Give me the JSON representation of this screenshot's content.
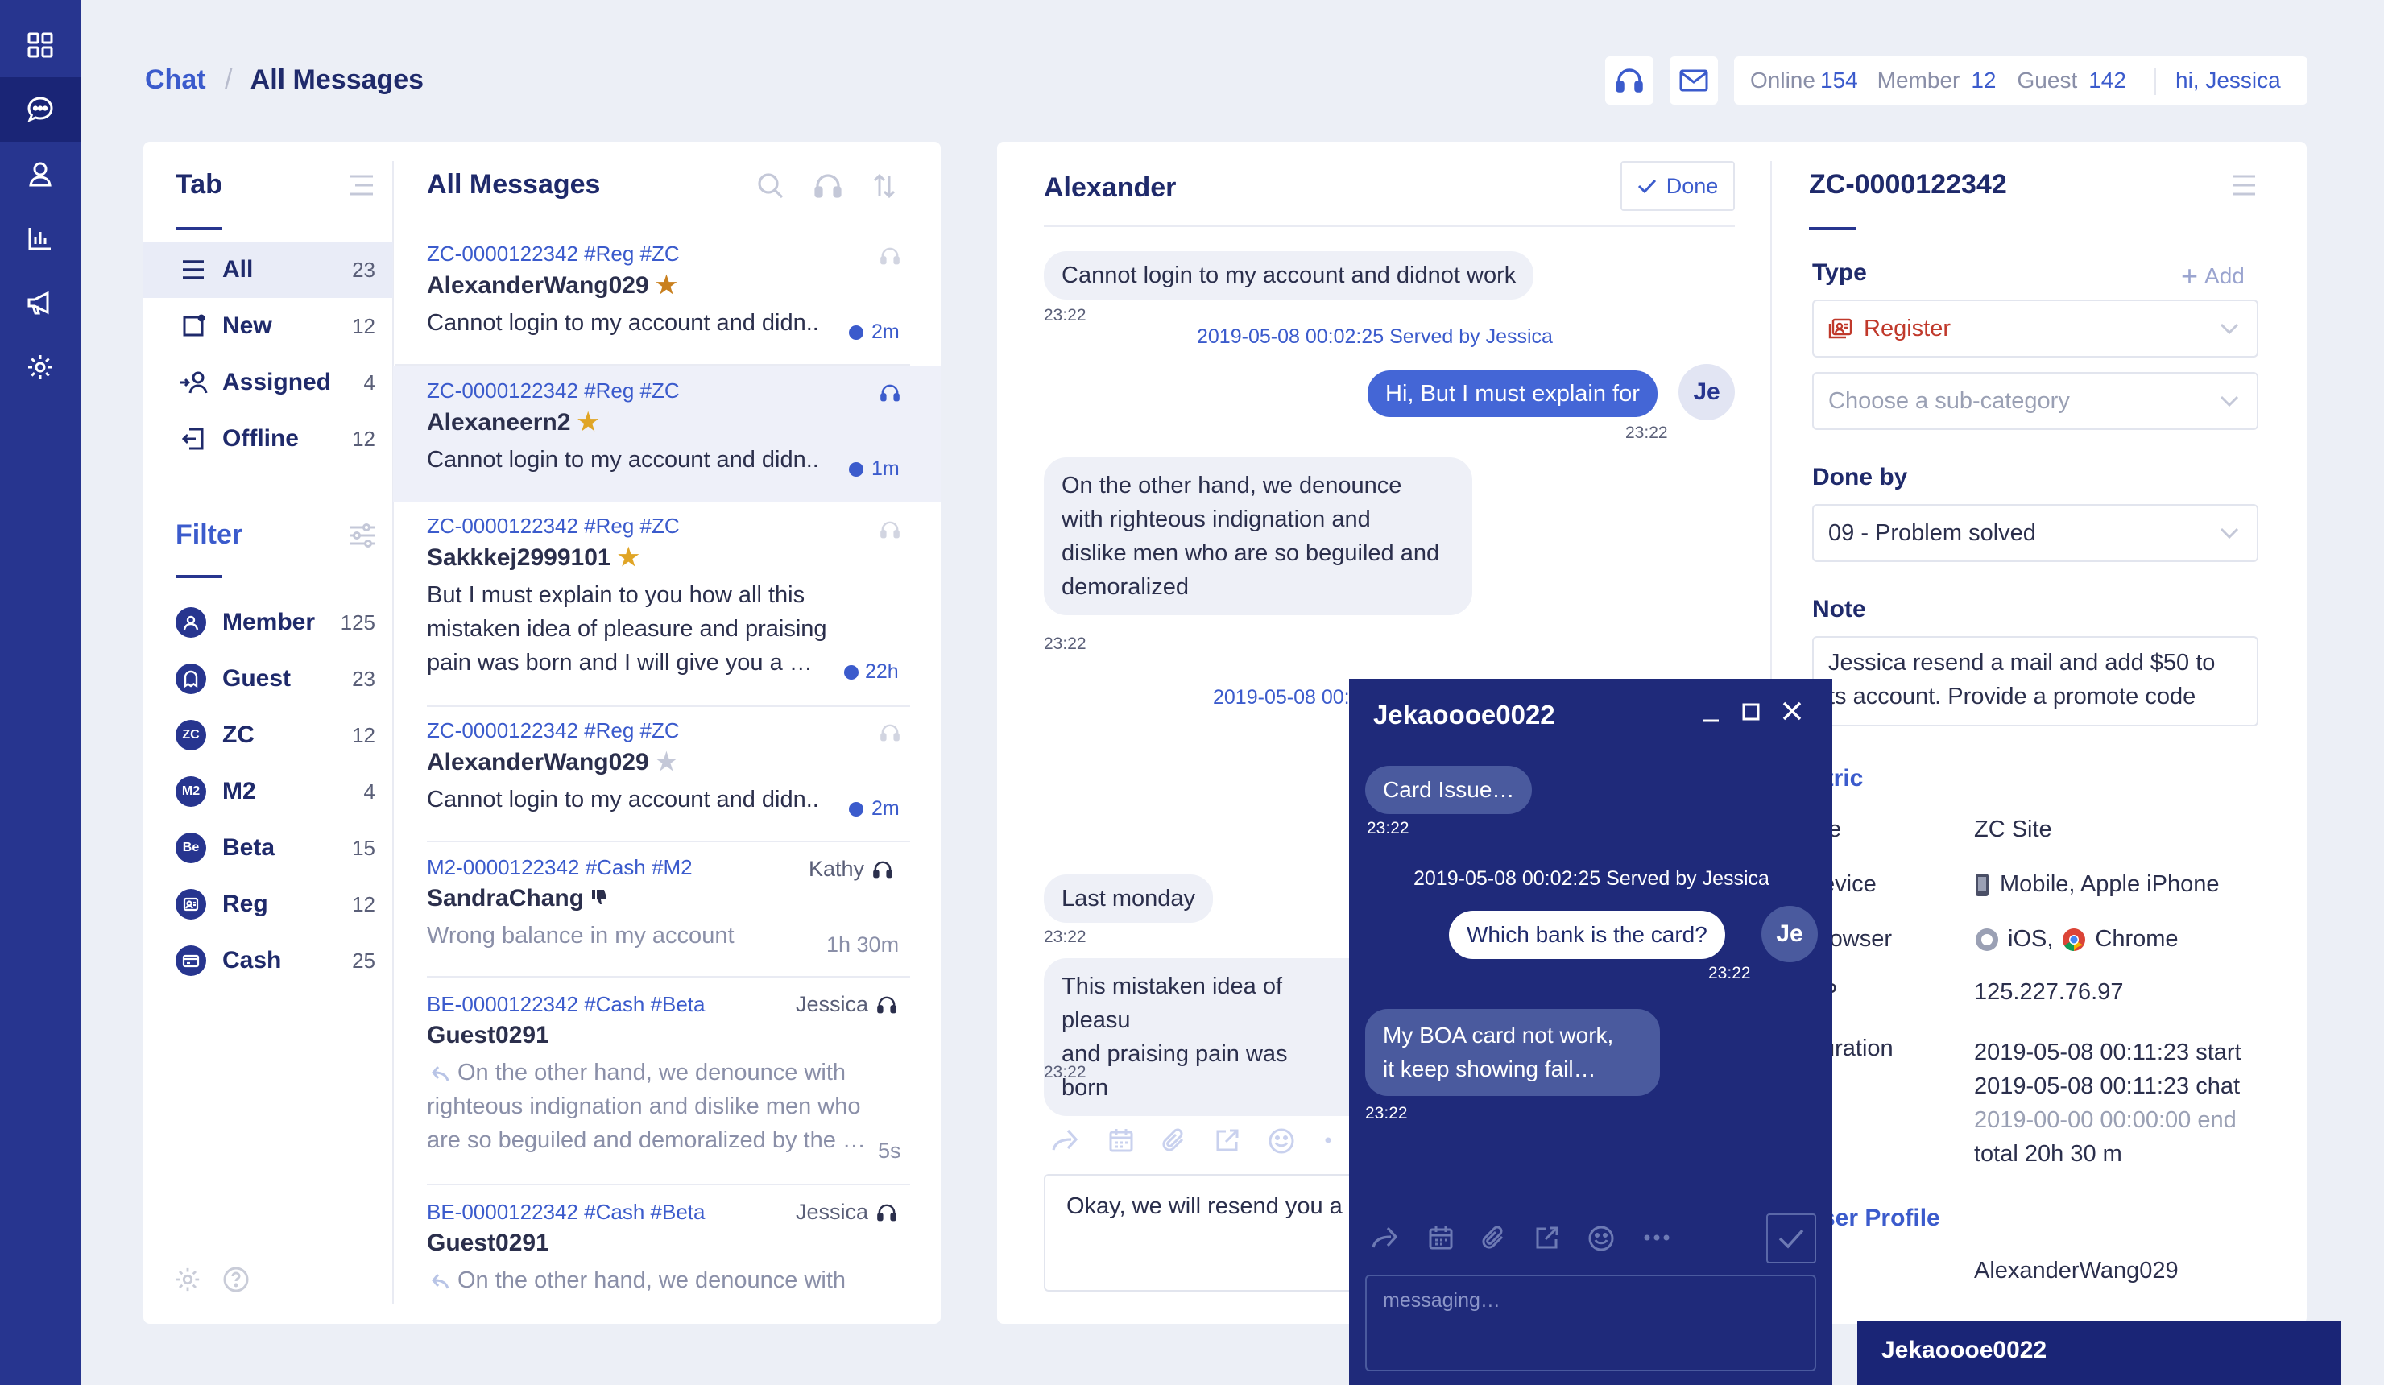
{
  "rail": {
    "items": [
      "grid-icon",
      "chat-icon",
      "user-icon",
      "chart-icon",
      "megaphone-icon",
      "gear-icon"
    ]
  },
  "header": {
    "crumb_root": "Chat",
    "crumb_sep": "/",
    "crumb_current": "All Messages",
    "online_label": "Online",
    "online_count": "154",
    "member_label": "Member",
    "member_count": "12",
    "guest_label": "Guest",
    "guest_count": "142",
    "greeting": "hi, Jessica"
  },
  "tabs": {
    "title": "Tab",
    "items": [
      {
        "label": "All",
        "count": "23"
      },
      {
        "label": "New",
        "count": "12"
      },
      {
        "label": "Assigned",
        "count": "4"
      },
      {
        "label": "Offline",
        "count": "12"
      }
    ]
  },
  "filters": {
    "title": "Filter",
    "items": [
      {
        "label": "Member",
        "count": "125",
        "badge": ""
      },
      {
        "label": "Guest",
        "count": "23",
        "badge": ""
      },
      {
        "label": "ZC",
        "count": "12",
        "badge": "ZC"
      },
      {
        "label": "M2",
        "count": "4",
        "badge": "M2"
      },
      {
        "label": "Beta",
        "count": "15",
        "badge": "Be"
      },
      {
        "label": "Reg",
        "count": "12",
        "badge": ""
      },
      {
        "label": "Cash",
        "count": "25",
        "badge": ""
      }
    ]
  },
  "messages": {
    "title": "All Messages",
    "items": [
      {
        "tags": "ZC-0000122342  #Reg  #ZC",
        "name": "AlexanderWang029",
        "body": "Cannot login to my account and didn..",
        "time": "2m",
        "agent": ""
      },
      {
        "tags": "ZC-0000122342  #Reg  #ZC",
        "name": "Alexaneern2",
        "body": "Cannot login to my account and didn..",
        "time": "1m",
        "agent": ""
      },
      {
        "tags": "ZC-0000122342  #Reg  #ZC",
        "name": "Sakkkej2999101",
        "body1": "But I must explain to you how all this",
        "body2": "mistaken idea of pleasure and praising",
        "body3": "pain was born and I will give you a …",
        "time": "22h",
        "agent": ""
      },
      {
        "tags": "ZC-0000122342  #Reg  #ZC",
        "name": "AlexanderWang029",
        "body": "Cannot login to my account and didn..",
        "time": "2m",
        "agent": ""
      },
      {
        "tags": "M2-0000122342  #Cash  #M2",
        "name": "SandraChang",
        "body": "Wrong balance in my account",
        "time": "1h 30m",
        "agent": "Kathy"
      },
      {
        "tags": "BE-0000122342  #Cash  #Beta",
        "name": "Guest0291",
        "body1": "On the other hand, we denounce with",
        "body2": "righteous indignation and dislike men who",
        "body3": "are so beguiled and demoralized by the …",
        "time": "5s",
        "agent": "Jessica"
      },
      {
        "tags": "BE-0000122342  #Cash  #Beta",
        "name": "Guest0291",
        "body1": "On the other hand, we denounce with",
        "time": "",
        "agent": "Jessica"
      }
    ]
  },
  "chat": {
    "title": "Alexander",
    "done_label": "Done",
    "m1": "Cannot login to my account and didnot work",
    "t1": "23:22",
    "served1": "2019-05-08 00:02:25  Served by Jessica",
    "m2": "Hi,  But I must explain for",
    "t2": "23:22",
    "avatar": "Je",
    "m3a": "On the other hand, we denounce",
    "m3b": "with righteous indignation and",
    "m3c": "dislike men who are so beguiled and",
    "m3d": "demoralized",
    "t3": "23:22",
    "served2": "2019-05-08 00:",
    "m4": "Last monday",
    "t4": "23:22",
    "m5a": "This mistaken idea of pleasu",
    "m5b": "and praising pain was born",
    "t5": "23:22",
    "input_value": "Okay, we will resend you a l"
  },
  "details": {
    "ticket": "ZC-0000122342",
    "type_label": "Type",
    "add_label": "Add",
    "type_value": "Register",
    "subcat_placeholder": "Choose a sub-category",
    "done_by_label": "Done by",
    "done_by_value": "09 - Problem solved",
    "note_label": "Note",
    "note_1": "Jessica resend a mail and add $50 to",
    "note_2": "ts account. Provide a promote code",
    "metric_label": "etric",
    "site_label": "te",
    "site_value": "ZC Site",
    "device_label": "evice",
    "device_value": "Mobile, Apple iPhone",
    "browser_label": "rowser",
    "browser_os": "iOS,",
    "browser_value": "Chrome",
    "ip_label": "P",
    "ip_value": "125.227.76.97",
    "duration_label": "uration",
    "dur1": "2019-05-08 00:11:23 start",
    "dur2": "2019-05-08 00:11:23 chat",
    "dur3": "2019-00-00 00:00:00 end",
    "dur4": "total 20h 30 m",
    "profile_label": "ser Profile",
    "profile_value": "AlexanderWang029"
  },
  "popup": {
    "title": "Jekaoooe0022",
    "m1": "Card Issue…",
    "t1": "23:22",
    "served": "2019-05-08 00:02:25  Served by Jessica",
    "m2": "Which bank is the card?",
    "t2": "23:22",
    "avatar": "Je",
    "m3a": "My BOA card not work,",
    "m3b": "it keep showing fail…",
    "t3": "23:22",
    "placeholder": "messaging…"
  },
  "minimized": {
    "title": "Jekaoooe0022"
  },
  "colors": {
    "rail": "#27358f",
    "accent": "#3b5bcc",
    "navy": "#1f2a6b",
    "popup": "#1f2a7a",
    "star": "#e0a526"
  }
}
